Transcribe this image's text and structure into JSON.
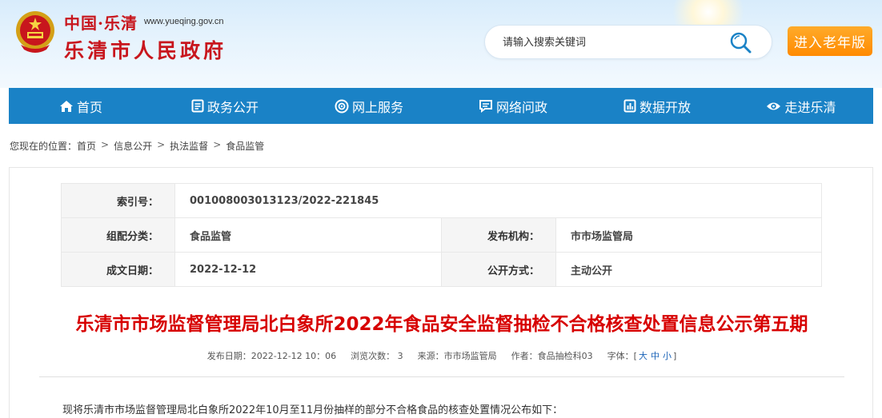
{
  "header": {
    "site_cn_prefix": "中国·乐清",
    "site_url": "www.yueqing.gov.cn",
    "site_title": "乐清市人民政府",
    "search_placeholder": "请输入搜索关键词",
    "elder_button": "进入老年版"
  },
  "nav": {
    "items": [
      {
        "label": "首页",
        "icon": "home-icon"
      },
      {
        "label": "政务公开",
        "icon": "document-icon"
      },
      {
        "label": "网上服务",
        "icon": "service-icon"
      },
      {
        "label": "网络问政",
        "icon": "message-icon"
      },
      {
        "label": "数据开放",
        "icon": "data-icon"
      },
      {
        "label": "走进乐清",
        "icon": "eye-icon"
      }
    ]
  },
  "breadcrumb": {
    "prefix": "您现在的位置：",
    "items": [
      "首页",
      "信息公开",
      "执法监督",
      "食品监管"
    ],
    "separator": ">"
  },
  "meta": {
    "index_label": "索引号：",
    "index_value": "001008003013123/2022-221845",
    "category_label": "组配分类：",
    "category_value": "食品监管",
    "publisher_label": "发布机构：",
    "publisher_value": "市市场监管局",
    "date_label": "成文日期：",
    "date_value": "2022-12-12",
    "method_label": "公开方式：",
    "method_value": "主动公开"
  },
  "article": {
    "title": "乐清市市场监督管理局北白象所2022年食品安全监督抽检不合格核查处置信息公示第五期",
    "publish_date": "发布日期：2022-12-12 10：06",
    "views": "浏览次数：  3",
    "source": "来源：市市场监管局",
    "author": "作者：食品抽检科03",
    "font_size_label": "字体：[",
    "font_large": "大",
    "font_medium": "中",
    "font_small": "小",
    "font_size_end": "]",
    "body_first_line": "现将乐清市市场监督管理局北白象所2022年10月至11月份抽样的部分不合格食品的核查处置情况公布如下："
  },
  "colors": {
    "nav_bg": "#1a82c6",
    "title_red": "#d70000",
    "elder_orange": "#ff8a00",
    "logo_red": "#c8161d"
  }
}
